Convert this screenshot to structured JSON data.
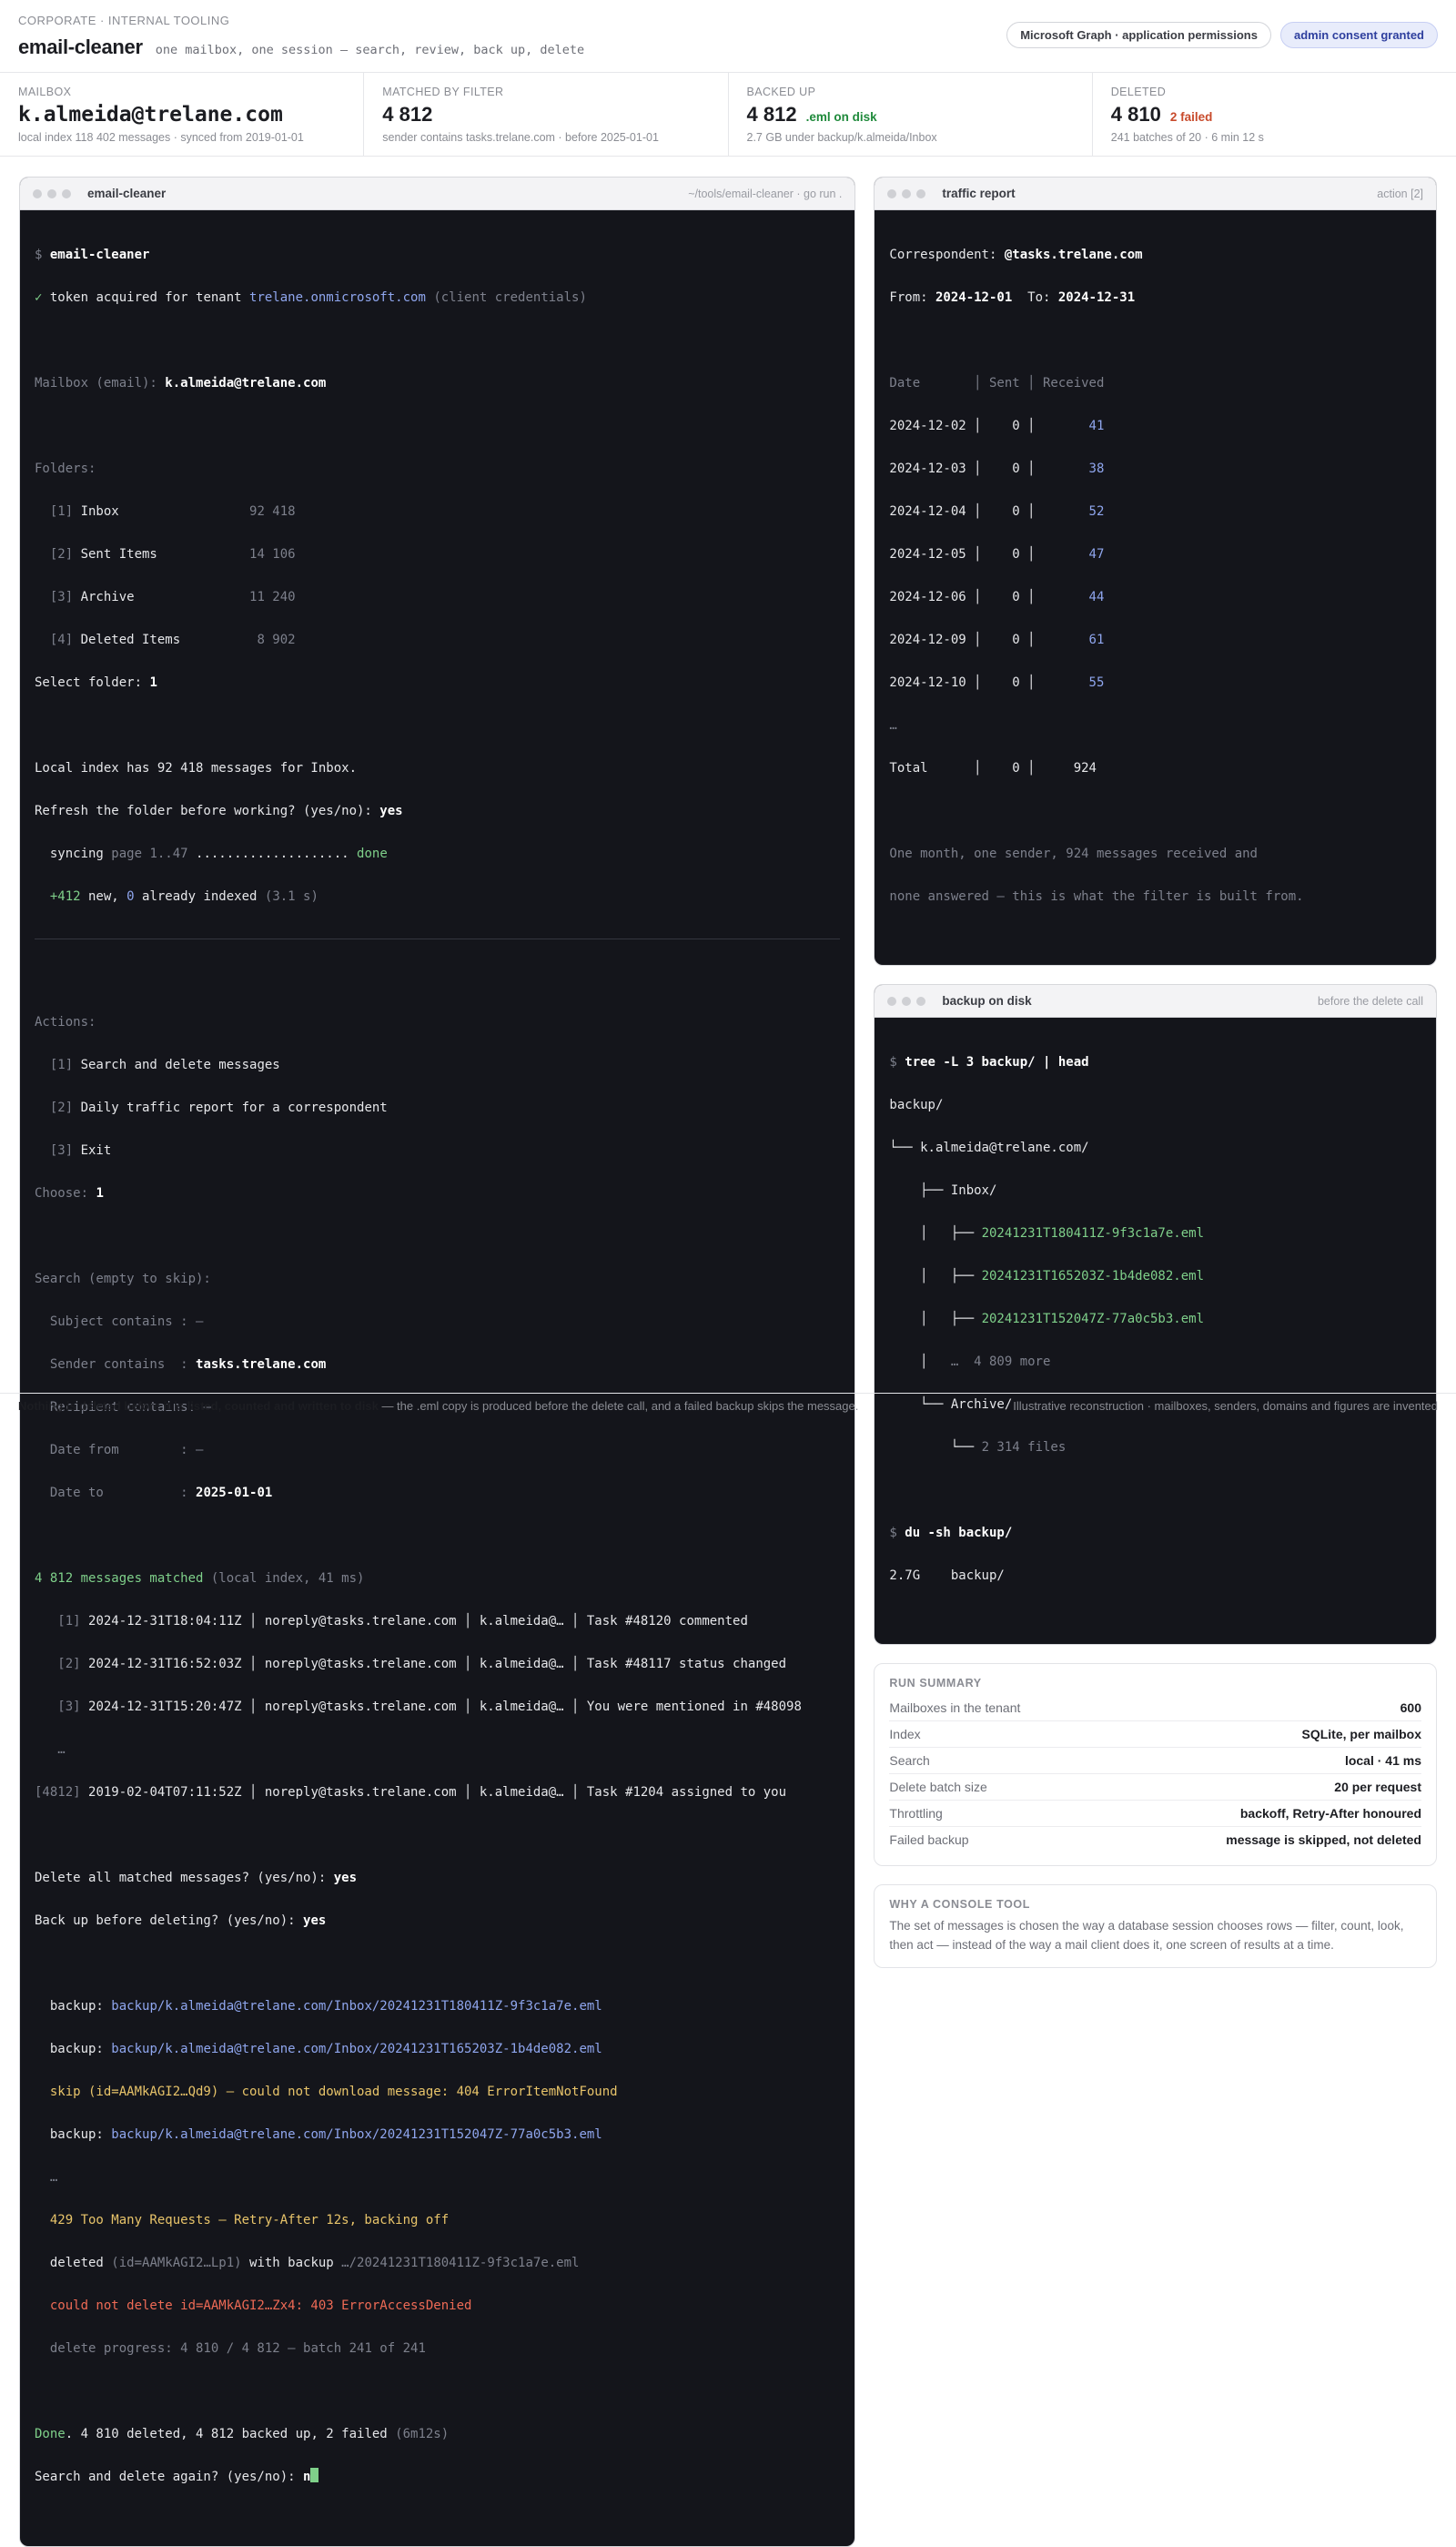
{
  "header": {
    "eyebrow": "CORPORATE · INTERNAL TOOLING",
    "title": "email-cleaner",
    "tagline": "one mailbox, one session — search, review, back up, delete",
    "badge_permissions": "Microsoft Graph · application permissions",
    "badge_consent": "admin consent granted"
  },
  "stats": [
    {
      "label": "MAILBOX",
      "value": "k.almeida@trelane.com",
      "note": "",
      "sub": "local index 118 402 messages · synced from 2019-01-01"
    },
    {
      "label": "MATCHED BY FILTER",
      "value": "4 812",
      "note": "",
      "sub": "sender contains tasks.trelane.com · before 2025-01-01"
    },
    {
      "label": "BACKED UP",
      "value": "4 812",
      "note": ".eml on disk",
      "sub": "2.7 GB under backup/k.almeida/Inbox"
    },
    {
      "label": "DELETED",
      "value": "4 810",
      "note": "2 failed",
      "sub": "241 batches of 20 · 6 min 12 s"
    }
  ],
  "console": {
    "title": "email-cleaner",
    "path": "~/tools/email-cleaner · go run .",
    "prompt": "$ ",
    "cmd": "email-cleaner",
    "token_check": "✓",
    "token_text": " token acquired for tenant ",
    "tenant": "trelane.onmicrosoft.com",
    "token_mode": " (client credentials)",
    "mailbox_prompt": "Mailbox (email): ",
    "mailbox_value": "k.almeida@trelane.com",
    "folders_label": "Folders:",
    "folders": [
      {
        "idx": "  [1] ",
        "name": "Inbox                 ",
        "count": "92 418"
      },
      {
        "idx": "  [2] ",
        "name": "Sent Items            ",
        "count": "14 106"
      },
      {
        "idx": "  [3] ",
        "name": "Archive               ",
        "count": "11 240"
      },
      {
        "idx": "  [4] ",
        "name": "Deleted Items         ",
        "count": " 8 902"
      }
    ],
    "select_folder_prompt": "Select folder: ",
    "select_folder_value": "1",
    "index_line": "Local index has 92 418 messages for Inbox.",
    "refresh_prompt": "Refresh the folder before working? (yes/no): ",
    "refresh_value": "yes",
    "sync_label": "  syncing ",
    "sync_pages": "page 1..47",
    "sync_dots": " .................... ",
    "sync_done": "done",
    "new_count": "  +412",
    "new_text": " new, ",
    "indexed_count": "0",
    "indexed_text": " already indexed ",
    "sync_time": "(3.1 s)",
    "actions_label": "Actions:",
    "actions": [
      {
        "idx": "  [1] ",
        "label": "Search and delete messages"
      },
      {
        "idx": "  [2] ",
        "label": "Daily traffic report for a correspondent"
      },
      {
        "idx": "  [3] ",
        "label": "Exit"
      }
    ],
    "choose_prompt": "Choose: ",
    "choose_value": "1",
    "search_label": "Search (empty to skip):",
    "fields": [
      {
        "label": "  Subject contains : ",
        "value": "—",
        "filled": false
      },
      {
        "label": "  Sender contains  : ",
        "value": "tasks.trelane.com",
        "filled": true
      },
      {
        "label": "  Recipient contains: ",
        "value": "—",
        "filled": false
      },
      {
        "label": "  Date from        : ",
        "value": "—",
        "filled": false
      },
      {
        "label": "  Date to          : ",
        "value": "2025-01-01",
        "filled": true
      }
    ],
    "matched": "4 812 messages matched",
    "matched_note": " (local index, 41 ms)",
    "results": [
      {
        "idx": "   [1] ",
        "row": "2024-12-31T18:04:11Z │ noreply@tasks.trelane.com │ k.almeida@… │ Task #48120 commented"
      },
      {
        "idx": "   [2] ",
        "row": "2024-12-31T16:52:03Z │ noreply@tasks.trelane.com │ k.almeida@… │ Task #48117 status changed"
      },
      {
        "idx": "   [3] ",
        "row": "2024-12-31T15:20:47Z │ noreply@tasks.trelane.com │ k.almeida@… │ You were mentioned in #48098"
      },
      {
        "idx": "   …",
        "row": ""
      },
      {
        "idx": "[4812] ",
        "row": "2019-02-04T07:11:52Z │ noreply@tasks.trelane.com │ k.almeida@… │ Task #1204 assigned to you"
      }
    ],
    "delete_prompt": "Delete all matched messages? (yes/no): ",
    "delete_value": "yes",
    "backup_prompt": "Back up before deleting? (yes/no): ",
    "backup_value": "yes",
    "backup_label": "  backup: ",
    "backup1": "backup/k.almeida@trelane.com/Inbox/20241231T180411Z-9f3c1a7e.eml",
    "backup2": "backup/k.almeida@trelane.com/Inbox/20241231T165203Z-1b4de082.eml",
    "skip_line": "  skip (id=AAMkAGI2…Qd9) — could not download message: 404 ErrorItemNotFound",
    "backup3": "backup/k.almeida@trelane.com/Inbox/20241231T152047Z-77a0c5b3.eml",
    "ellipsis": "  …",
    "throttle_line": "  429 Too Many Requests — Retry-After 12s, backing off",
    "deleted_label": "  deleted ",
    "deleted_id": "(id=AAMkAGI2…Lp1)",
    "deleted_text": " with backup ",
    "deleted_path": "…/20241231T180411Z-9f3c1a7e.eml",
    "error_line": "  could not delete id=AAMkAGI2…Zx4: 403 ErrorAccessDenied",
    "progress_label": "  delete progress: 4 810 / 4 812 ",
    "progress_batch": "— batch 241 of 241",
    "done_word": "Done",
    "done_text": ". 4 810 deleted, 4 812 backed up, 2 failed ",
    "done_time": "(6m12s)",
    "again_prompt": "Search and delete again? (yes/no): ",
    "again_value": "n"
  },
  "traffic": {
    "title": "traffic report",
    "right": "action [2]",
    "corr_label": "Correspondent: ",
    "corr_value": "@tasks.trelane.com",
    "from_label": "From: ",
    "from_value": "2024-12-01",
    "to_label": "  To: ",
    "to_value": "2024-12-31",
    "header": "Date       │ Sent │ Received",
    "rows": [
      {
        "date": "2024-12-02 │    0 │ ",
        "recv": "      41"
      },
      {
        "date": "2024-12-03 │    0 │ ",
        "recv": "      38"
      },
      {
        "date": "2024-12-04 │    0 │ ",
        "recv": "      52"
      },
      {
        "date": "2024-12-05 │    0 │ ",
        "recv": "      47"
      },
      {
        "date": "2024-12-06 │    0 │ ",
        "recv": "      44"
      },
      {
        "date": "2024-12-09 │    0 │ ",
        "recv": "      61"
      },
      {
        "date": "2024-12-10 │    0 │ ",
        "recv": "      55"
      }
    ],
    "ellipsis": "…",
    "total": "Total      │    0 │     924",
    "note1": "One month, one sender, 924 messages received and",
    "note2": "none answered — this is what the filter is built from."
  },
  "backup_disk": {
    "title": "backup on disk",
    "right": "before the delete call",
    "cmd1": "tree -L 3 backup/ | head",
    "l1": "backup/",
    "l2": "└── k.almeida@trelane.com/",
    "l3": "    ├── Inbox/",
    "f1_prefix": "    │   ├── ",
    "f1": "20241231T180411Z-9f3c1a7e.eml",
    "f2_prefix": "    │   ├── ",
    "f2": "20241231T165203Z-1b4de082.eml",
    "f3_prefix": "    │   ├── ",
    "f3": "20241231T152047Z-77a0c5b3.eml",
    "more_prefix": "    │   ",
    "more": "…  4 809 more",
    "archive": "    └── Archive/",
    "files_prefix": "        └── ",
    "files": "2 314 files",
    "cmd2": "du -sh backup/",
    "du_out": "2.7G    backup/"
  },
  "summary": {
    "title": "RUN SUMMARY",
    "rows": [
      {
        "k": "Mailboxes in the tenant",
        "v": "600"
      },
      {
        "k": "Index",
        "v": "SQLite, per mailbox"
      },
      {
        "k": "Search",
        "v": "local · 41 ms"
      },
      {
        "k": "Delete batch size",
        "v": "20 per request"
      },
      {
        "k": "Throttling",
        "v": "backoff, Retry-After honoured"
      },
      {
        "k": "Failed backup",
        "v": "message is skipped, not deleted"
      }
    ]
  },
  "why": {
    "title": "WHY A CONSOLE TOOL",
    "text": "The set of messages is chosen the way a database session chooses rows — filter, count, look, then act — instead of the way a mail client does it, one screen of results at a time."
  },
  "footer": {
    "bold": "Nothing is deleted before it is listed, counted and written to disk",
    "rest": " — the .eml copy is produced before the delete call, and a failed backup skips the message.",
    "right": "Illustrative reconstruction · mailboxes, senders, domains and figures are invented"
  },
  "colors": {
    "accent": "#2e3f9e",
    "terminal_bg": "#14151b",
    "ok": "#7fd08a",
    "link": "#8fa6ee",
    "warn": "#e8c46a",
    "error": "#ee6a55"
  }
}
